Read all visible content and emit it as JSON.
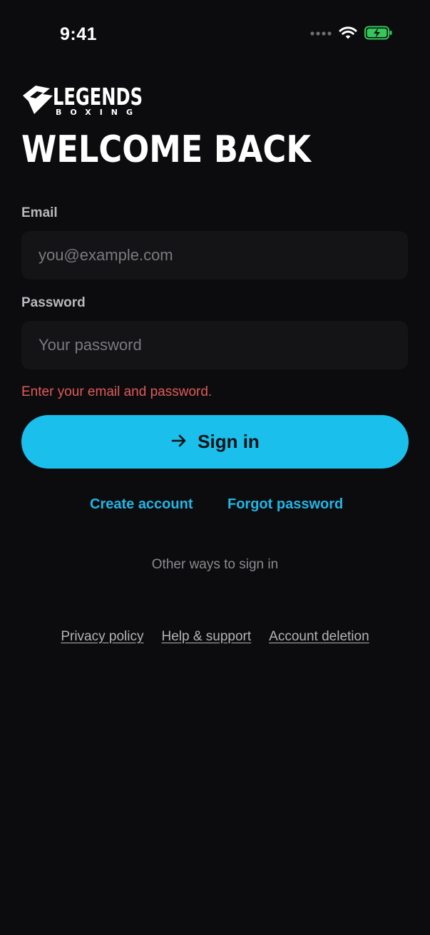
{
  "status_bar": {
    "time": "9:41",
    "icons": [
      "signal-dots-icon",
      "wifi-icon",
      "battery-charging-icon"
    ],
    "battery_color": "#34c759"
  },
  "brand": {
    "logo_primary": "LEGENDS",
    "logo_secondary": "BOXING"
  },
  "page": {
    "title": "WELCOME BACK"
  },
  "form": {
    "email_label": "Email",
    "email_placeholder": "you@example.com",
    "email_value": "",
    "password_label": "Password",
    "password_placeholder": "Your password",
    "password_value": "",
    "error_message": "Enter your email and password.",
    "submit_label": "Sign in",
    "submit_icon": "arrow-right-icon"
  },
  "links": {
    "create_account": "Create account",
    "forgot_password": "Forgot password",
    "other_ways": "Other ways to sign in"
  },
  "footer": {
    "privacy": "Privacy policy",
    "help": "Help & support",
    "account_deletion": "Account deletion"
  },
  "colors": {
    "background": "#0c0c0e",
    "accent": "#1bbfec",
    "link": "#21b6e6",
    "error": "#e05a5a",
    "input_bg": "#141416"
  }
}
